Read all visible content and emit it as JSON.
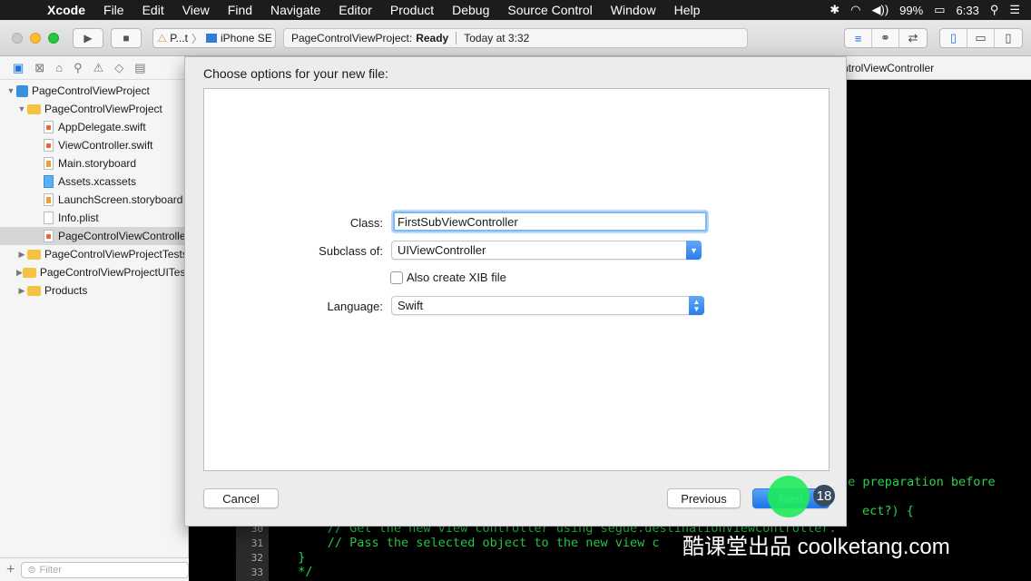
{
  "menubar": {
    "items": [
      "Xcode",
      "File",
      "Edit",
      "View",
      "Find",
      "Navigate",
      "Editor",
      "Product",
      "Debug",
      "Source Control",
      "Window",
      "Help"
    ],
    "battery": "99%",
    "time": "6:33"
  },
  "toolbar": {
    "scheme_target": "P...t",
    "device": "iPhone SE",
    "status_project": "PageControlViewProject:",
    "status_state": "Ready",
    "status_time": "Today at 3:32"
  },
  "navigator": {
    "items": [
      {
        "label": "PageControlViewProject",
        "type": "project",
        "indent": 0,
        "disclosure": "open"
      },
      {
        "label": "PageControlViewProject",
        "type": "folder",
        "indent": 1,
        "disclosure": "open"
      },
      {
        "label": "AppDelegate.swift",
        "type": "swift",
        "indent": 2
      },
      {
        "label": "ViewController.swift",
        "type": "swift",
        "indent": 2
      },
      {
        "label": "Main.storyboard",
        "type": "storyboard",
        "indent": 2
      },
      {
        "label": "Assets.xcassets",
        "type": "assets",
        "indent": 2
      },
      {
        "label": "LaunchScreen.storyboard",
        "type": "storyboard",
        "indent": 2
      },
      {
        "label": "Info.plist",
        "type": "plist",
        "indent": 2
      },
      {
        "label": "PageControlViewController",
        "type": "swift",
        "indent": 2,
        "selected": true
      },
      {
        "label": "PageControlViewProjectTests",
        "type": "folder",
        "indent": 1,
        "disclosure": "closed"
      },
      {
        "label": "PageControlViewProjectUITests",
        "type": "folder",
        "indent": 1,
        "disclosure": "closed"
      },
      {
        "label": "Products",
        "type": "folder",
        "indent": 1,
        "disclosure": "closed"
      }
    ],
    "filter_placeholder": "Filter"
  },
  "editor": {
    "jumpbar_crumb": "ntrolViewController",
    "code_lines": [
      {
        "num": "",
        "text": "le preparation before",
        "partial": true
      },
      {
        "num": "",
        "text": "ect?) {",
        "partial": true
      },
      {
        "num": "30",
        "text": "      // Get the new view controller using segue.destinationViewController."
      },
      {
        "num": "31",
        "text": "      // Pass the selected object to the new view c"
      },
      {
        "num": "32",
        "text": "  }"
      },
      {
        "num": "33",
        "text": "  */"
      }
    ]
  },
  "dialog": {
    "title": "Choose options for your new file:",
    "class_label": "Class:",
    "class_value": "FirstSubViewController",
    "subclass_label": "Subclass of:",
    "subclass_value": "UIViewController",
    "xib_label": "Also create XIB file",
    "xib_checked": false,
    "language_label": "Language:",
    "language_value": "Swift",
    "cancel": "Cancel",
    "previous": "Previous",
    "next": "Next"
  },
  "overlay": {
    "step_badge": "18",
    "watermark": "酷课堂出品 coolketang.com"
  }
}
